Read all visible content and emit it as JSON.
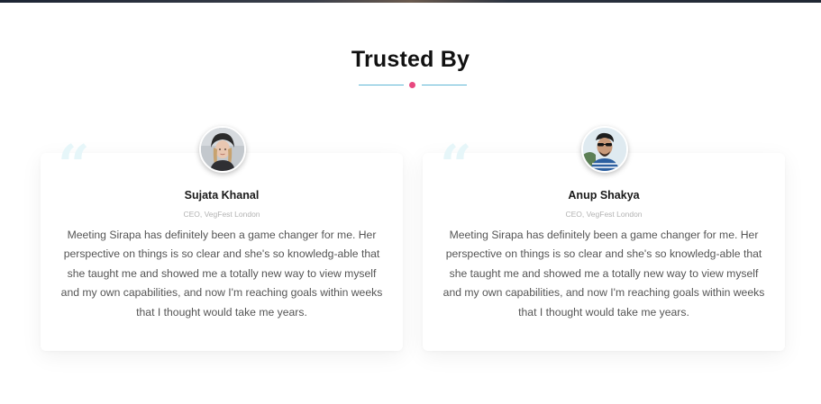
{
  "section": {
    "title": "Trusted By"
  },
  "testimonials": [
    {
      "name": "Sujata Khanal",
      "role": "CEO, VegFest London",
      "quote": "Meeting Sirapa has definitely been a game changer for me. Her perspective on things is so clear and she's so knowledg-able that she taught me and showed me a totally new way to view myself and my own capabilities, and now I'm reaching goals within weeks that I thought would take me years."
    },
    {
      "name": "Anup Shakya",
      "role": "CEO, VegFest London",
      "quote": "Meeting Sirapa has definitely been a game changer for me. Her perspective on things is so clear and she's so knowledg-able that she taught me and showed me a totally new way to view myself and my own capabilities, and now I'm reaching goals within weeks that I thought would take me years."
    }
  ],
  "colors": {
    "accent_dot": "#e8487f",
    "divider_line": "#5fb6d6",
    "quote_mark": "#e6f6f9"
  },
  "icons": {
    "quote": "quote-icon"
  }
}
